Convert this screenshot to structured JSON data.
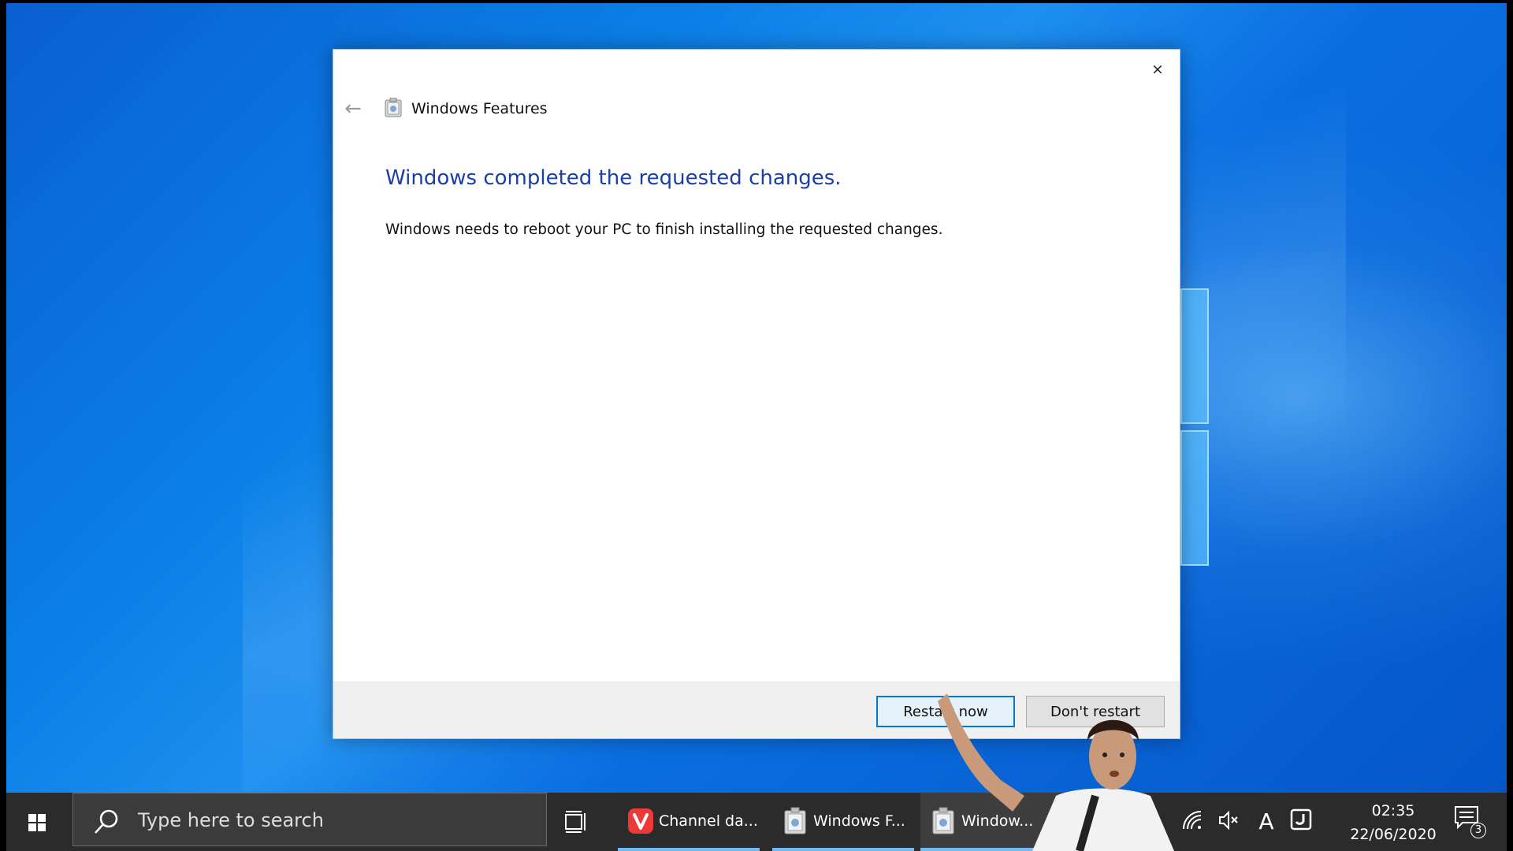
{
  "dialog": {
    "app_title": "Windows Features",
    "heading": "Windows completed the requested changes.",
    "message": "Windows needs to reboot your PC to finish installing the requested changes.",
    "close_glyph": "×",
    "back_glyph": "←",
    "buttons": {
      "restart_now": "Restart now",
      "dont_restart": "Don't restart"
    }
  },
  "taskbar": {
    "search_placeholder": "Type here to search",
    "apps": [
      {
        "label": "Channel da...",
        "icon": "vivaldi-icon"
      },
      {
        "label": "Windows F...",
        "icon": "windows-features-icon"
      },
      {
        "label": "Window...",
        "icon": "windows-features-icon"
      }
    ],
    "clock": {
      "time": "02:35",
      "date": "22/06/2020"
    },
    "notification_count": "3",
    "tray": {
      "language_glyph": "A"
    }
  },
  "colors": {
    "heading": "#1a3fa6",
    "accent": "#0078d7",
    "taskbar": "#2b2b2b",
    "vivaldi": "#ef3939"
  }
}
